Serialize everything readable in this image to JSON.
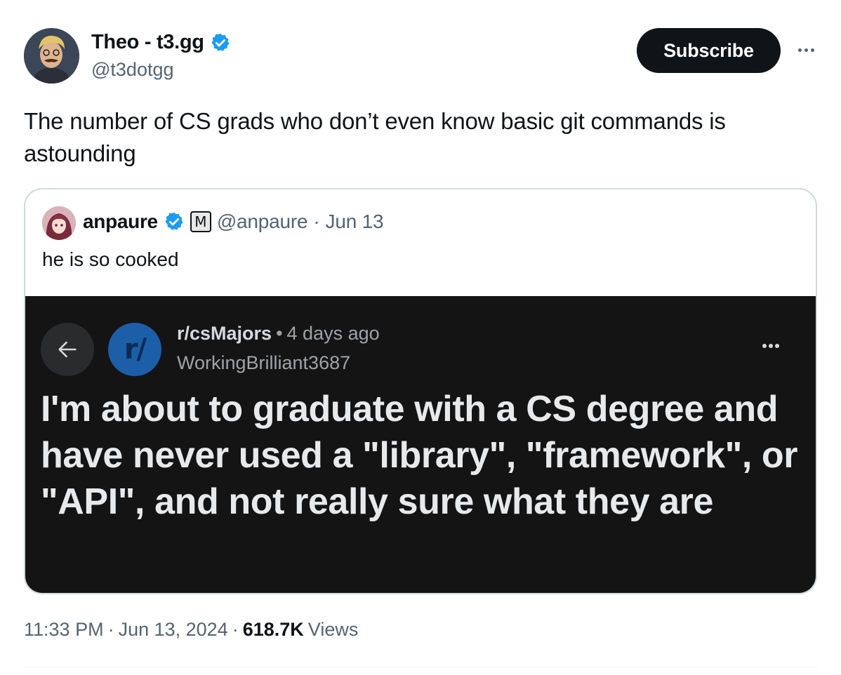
{
  "author": {
    "name": "Theo - t3.gg",
    "handle": "@t3dotgg",
    "verified": true,
    "verified_color": "#1d9bf0"
  },
  "actions": {
    "subscribe_label": "Subscribe",
    "more_icon": "more-horizontal-icon"
  },
  "tweet": {
    "text": "The number of CS grads who don’t even know basic git commands is astounding"
  },
  "quote": {
    "name": "anpaure",
    "badge": "M",
    "handle": "@anpaure",
    "separator": "·",
    "date": "Jun 13",
    "text": "he is so cooked",
    "media": {
      "back_icon": "arrow-left-icon",
      "subreddit_icon_text": "r/",
      "subreddit": "r/csMajors",
      "dot": "•",
      "time": "4 days ago",
      "username": "WorkingBrilliant3687",
      "title": "I'm about to graduate with a CS degree and have never used a \"library\", \"framework\", or \"API\", and not really sure what they are"
    }
  },
  "meta": {
    "time": "11:33 PM",
    "sep1": "·",
    "date": "Jun 13, 2024",
    "sep2": "·",
    "views_count": "618.7K",
    "views_label": "Views"
  }
}
